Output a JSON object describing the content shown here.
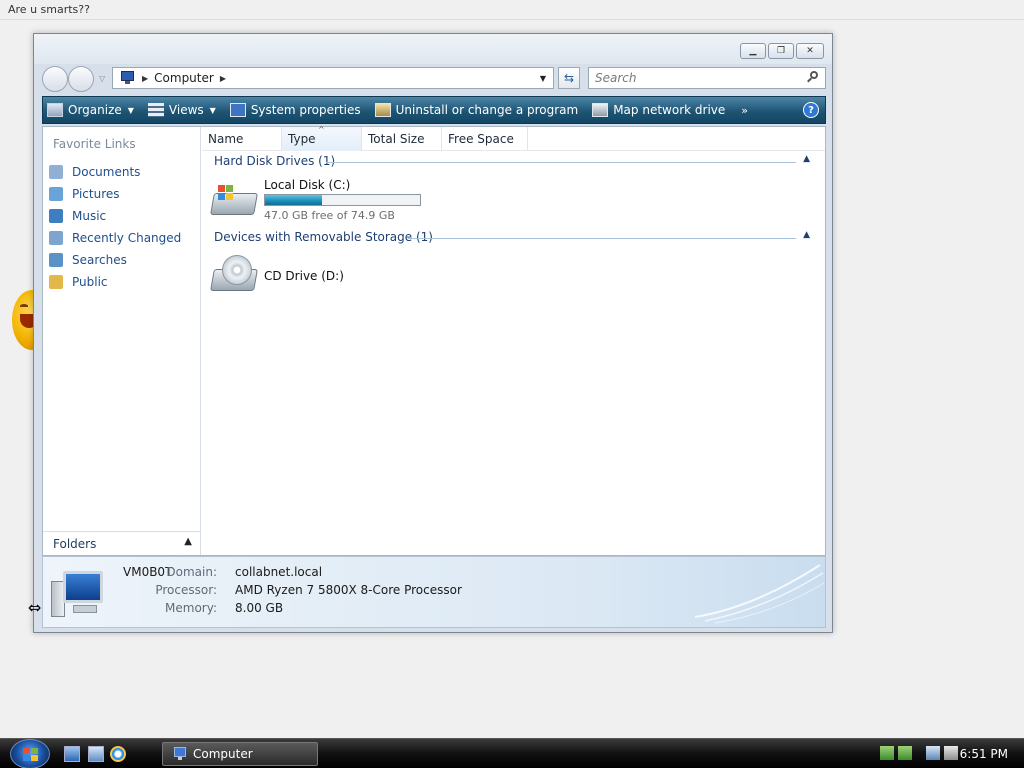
{
  "topstrip": {
    "title": "Are u smarts??"
  },
  "window": {
    "controls": {
      "minimize": "▁",
      "maximize": "❐",
      "close": "✕"
    },
    "address": {
      "location": "Computer"
    },
    "search": {
      "placeholder": "Search"
    },
    "toolbar": {
      "items": [
        {
          "label": "Organize",
          "has_dropdown": true
        },
        {
          "label": "Views",
          "has_dropdown": true
        },
        {
          "label": "System properties",
          "has_dropdown": false
        },
        {
          "label": "Uninstall or change a program",
          "has_dropdown": false
        },
        {
          "label": "Map network drive",
          "has_dropdown": false
        }
      ],
      "more": "»",
      "help": "?"
    },
    "navpane": {
      "heading": "Favorite Links",
      "links": [
        {
          "label": "Documents",
          "icon": "documents-icon",
          "color": "#8fb0d3"
        },
        {
          "label": "Pictures",
          "icon": "pictures-icon",
          "color": "#6aa3d8"
        },
        {
          "label": "Music",
          "icon": "music-icon",
          "color": "#3f7fc1"
        },
        {
          "label": "Recently Changed",
          "icon": "recent-icon",
          "color": "#7da6cf"
        },
        {
          "label": "Searches",
          "icon": "searches-icon",
          "color": "#5b92c8"
        },
        {
          "label": "Public",
          "icon": "public-folder-icon",
          "color": "#e2b84a"
        }
      ],
      "folders_label": "Folders"
    },
    "columns": [
      "Name",
      "Type",
      "Total Size",
      "Free Space"
    ],
    "groups": {
      "hard_disk": {
        "title": "Hard Disk Drives (1)",
        "drive": {
          "label": "Local Disk (C:)",
          "free_text": "47.0 GB free of 74.9 GB",
          "used_fraction": 0.37
        }
      },
      "removable": {
        "title": "Devices with Removable Storage (1)",
        "drive": {
          "label": "CD Drive (D:)"
        }
      }
    },
    "details": {
      "computer_name": "VM0B0T",
      "domain_label": "Domain:",
      "domain_value": "collabnet.local",
      "processor_label": "Processor:",
      "processor_value": "AMD Ryzen 7 5800X 8-Core Processor",
      "memory_label": "Memory:",
      "memory_value": "8.00 GB"
    }
  },
  "taskbar": {
    "task_button": "Computer",
    "clock": "6:51 PM"
  }
}
